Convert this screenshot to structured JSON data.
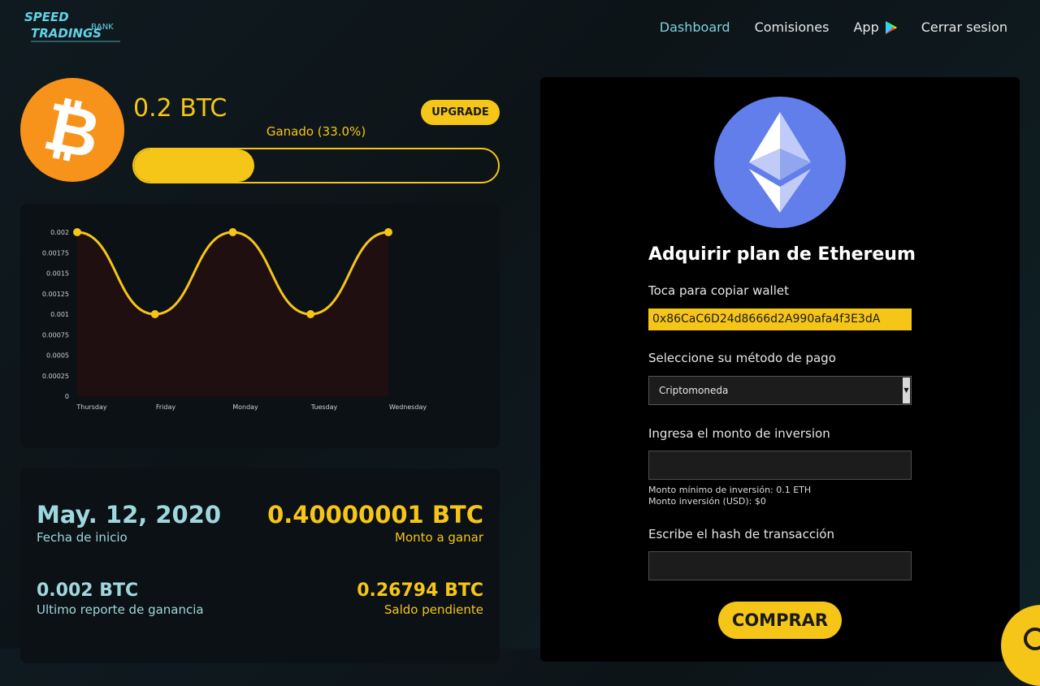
{
  "nav": {
    "logo_line1": "SPEED",
    "logo_line2": "TRADINGS",
    "logo_sub": "BANK",
    "links": [
      {
        "label": "Dashboard",
        "active": true
      },
      {
        "label": "Comisiones",
        "active": false
      },
      {
        "label": "App",
        "active": false
      },
      {
        "label": "Cerrar sesion",
        "active": false
      }
    ]
  },
  "balance": {
    "amount": "0.2 BTC",
    "upgrade_label": "UPGRADE",
    "earned_label": "Ganado (33.0%)",
    "progress_percent": 33
  },
  "chart_data": {
    "type": "area",
    "x": [
      "Thursday",
      "Friday",
      "Monday",
      "Tuesday",
      "Wednesday"
    ],
    "series": [
      {
        "values": [
          0.002,
          0.001,
          0.002,
          0.001,
          0.002
        ]
      }
    ],
    "ylim": [
      0,
      0.002
    ],
    "yticks": [
      "0.002",
      "0.00175",
      "0.0015",
      "0.00125",
      "0.001",
      "0.00075",
      "0.0005",
      "0.00025",
      "0"
    ],
    "line_color": "#f5c518",
    "fill_color": "#1f0f10",
    "grid": false
  },
  "stats": {
    "start_date": "May. 12, 2020",
    "start_label": "Fecha de inicio",
    "to_earn": "0.40000001 BTC",
    "to_earn_label": "Monto a ganar",
    "last_report": "0.002 BTC",
    "last_report_label": "Ultimo reporte de ganancia",
    "pending": "0.26794 BTC",
    "pending_label": "Saldo pendiente"
  },
  "eth_form": {
    "title": "Adquirir plan de Ethereum",
    "wallet_label": "Toca para copiar wallet",
    "wallet_value": "0x86CaC6D24d8666d2A990afa4f3E3dA",
    "payment_label": "Seleccione su método de pago",
    "payment_selected": "Criptomoneda",
    "amount_label": "Ingresa el monto de inversion",
    "min_note_1": "Monto mínimo de inversión: 0.1 ETH",
    "min_note_2": "Monto inversión (USD): $0",
    "hash_label": "Escribe el hash de transacción",
    "buy_label": "COMPRAR"
  },
  "colors": {
    "accent": "#f5c518",
    "teal": "#9fd7df",
    "btc": "#f7931a",
    "eth": "#627eea"
  }
}
